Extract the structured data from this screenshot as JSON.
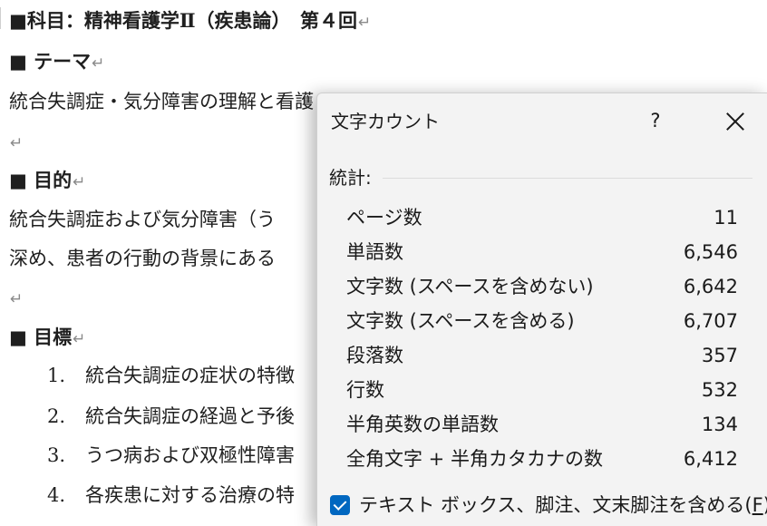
{
  "document": {
    "title": "■科目：精神看護学Ⅱ（疾患論）　第４回",
    "heading_theme": "■ テーマ",
    "theme_text": "統合失調症・気分障害の理解と看護",
    "heading_purpose": "■ 目的",
    "purpose_line1": "統合失調症および気分障害（う",
    "purpose_line2": "深め、患者の行動の背景にある",
    "heading_goals": "■ 目標",
    "goals": [
      {
        "num": "1.",
        "text": "統合失調症の症状の特徴"
      },
      {
        "num": "2.",
        "text": "統合失調症の経過と予後"
      },
      {
        "num": "3.",
        "text": "うつ病および双極性障害"
      },
      {
        "num": "4.",
        "text": "各疾患に対する治療の特"
      }
    ],
    "paragraph_mark": "↵"
  },
  "dialog": {
    "title": "文字カウント",
    "help_label": "?",
    "close_icon": "close-icon",
    "section_label": "統計:",
    "stats": [
      {
        "label": "ページ数",
        "value": "11"
      },
      {
        "label": "単語数",
        "value": "6,546"
      },
      {
        "label": "文字数 (スペースを含めない)",
        "value": "6,642"
      },
      {
        "label": "文字数 (スペースを含める)",
        "value": "6,707"
      },
      {
        "label": "段落数",
        "value": "357"
      },
      {
        "label": "行数",
        "value": "532"
      },
      {
        "label": "半角英数の単語数",
        "value": "134"
      },
      {
        "label": "全角文字 + 半角カタカナの数",
        "value": "6,412"
      }
    ],
    "checkbox": {
      "label": "テキスト ボックス、脚注、文末脚注を含める(",
      "accel_key": "F",
      "label_end": ")",
      "checked": true,
      "color": "#0067c0"
    }
  }
}
